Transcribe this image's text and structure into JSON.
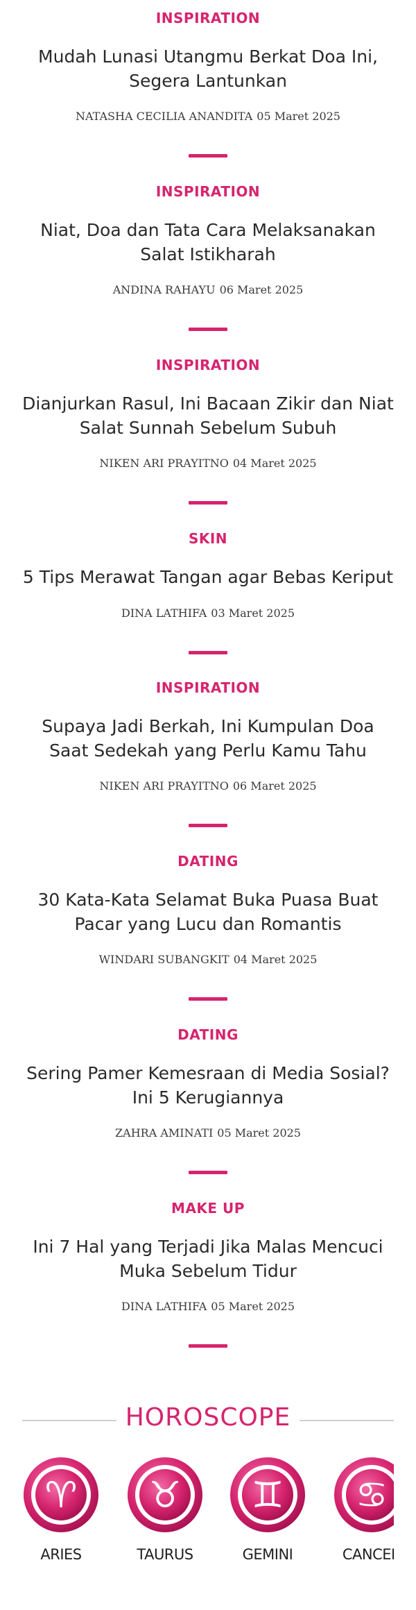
{
  "articles": [
    {
      "category": "INSPIRATION",
      "title": "Mudah Lunasi Utangmu Berkat Doa Ini, Segera Lantunkan",
      "author": "NATASHA CECILIA ANANDITA",
      "date": "05 Maret 2025"
    },
    {
      "category": "INSPIRATION",
      "title": "Niat, Doa dan Tata Cara Melaksanakan Salat Istikharah",
      "author": "ANDINA RAHAYU",
      "date": "06 Maret 2025"
    },
    {
      "category": "INSPIRATION",
      "title": "Dianjurkan Rasul, Ini Bacaan Zikir dan Niat Salat Sunnah Sebelum Subuh",
      "author": "NIKEN ARI PRAYITNO",
      "date": "04 Maret 2025"
    },
    {
      "category": "SKIN",
      "title": "5 Tips Merawat Tangan agar Bebas Keriput",
      "author": "DINA LATHIFA",
      "date": "03 Maret 2025"
    },
    {
      "category": "INSPIRATION",
      "title": "Supaya Jadi Berkah, Ini Kumpulan Doa Saat Sedekah yang Perlu Kamu Tahu",
      "author": "NIKEN ARI PRAYITNO",
      "date": "06 Maret 2025"
    },
    {
      "category": "DATING",
      "title": "30 Kata-Kata Selamat Buka Puasa Buat Pacar yang Lucu dan Romantis",
      "author": "WINDARI SUBANGKIT",
      "date": "04 Maret 2025"
    },
    {
      "category": "DATING",
      "title": "Sering Pamer Kemesraan di Media Sosial? Ini 5 Kerugiannya",
      "author": "ZAHRA AMINATI",
      "date": "05 Maret 2025"
    },
    {
      "category": "MAKE UP",
      "title": "Ini 7 Hal yang Terjadi Jika Malas Mencuci Muka Sebelum Tidur",
      "author": "DINA LATHIFA",
      "date": "05 Maret 2025"
    }
  ],
  "horoscope": {
    "title": "HOROSCOPE",
    "signs": [
      {
        "name": "ARIES",
        "glyph": "♈",
        "icon": "aries-icon"
      },
      {
        "name": "TAURUS",
        "glyph": "♉",
        "icon": "taurus-icon"
      },
      {
        "name": "GEMINI",
        "glyph": "♊",
        "icon": "gemini-icon"
      },
      {
        "name": "CANCER",
        "glyph": "♋",
        "icon": "cancer-icon"
      }
    ]
  },
  "colors": {
    "accent": "#d6246e",
    "text": "#2a2a2a",
    "rule": "#cfcfcf"
  }
}
